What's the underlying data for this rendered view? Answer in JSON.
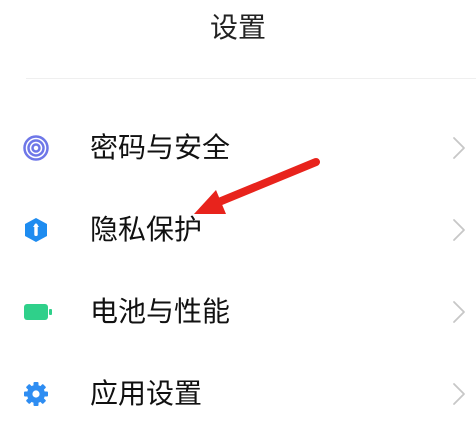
{
  "header": {
    "title": "设置"
  },
  "menu": {
    "items": [
      {
        "label": "密码与安全",
        "icon": "fingerprint-icon",
        "icon_color": "#6E77E8"
      },
      {
        "label": "隐私保护",
        "icon": "privacy-shield-icon",
        "icon_color": "#1E8CF0"
      },
      {
        "label": "电池与性能",
        "icon": "battery-icon",
        "icon_color": "#2FD08A"
      },
      {
        "label": "应用设置",
        "icon": "gear-icon",
        "icon_color": "#2E8DF2"
      }
    ]
  },
  "annotation": {
    "arrow_color": "#E8231C"
  }
}
